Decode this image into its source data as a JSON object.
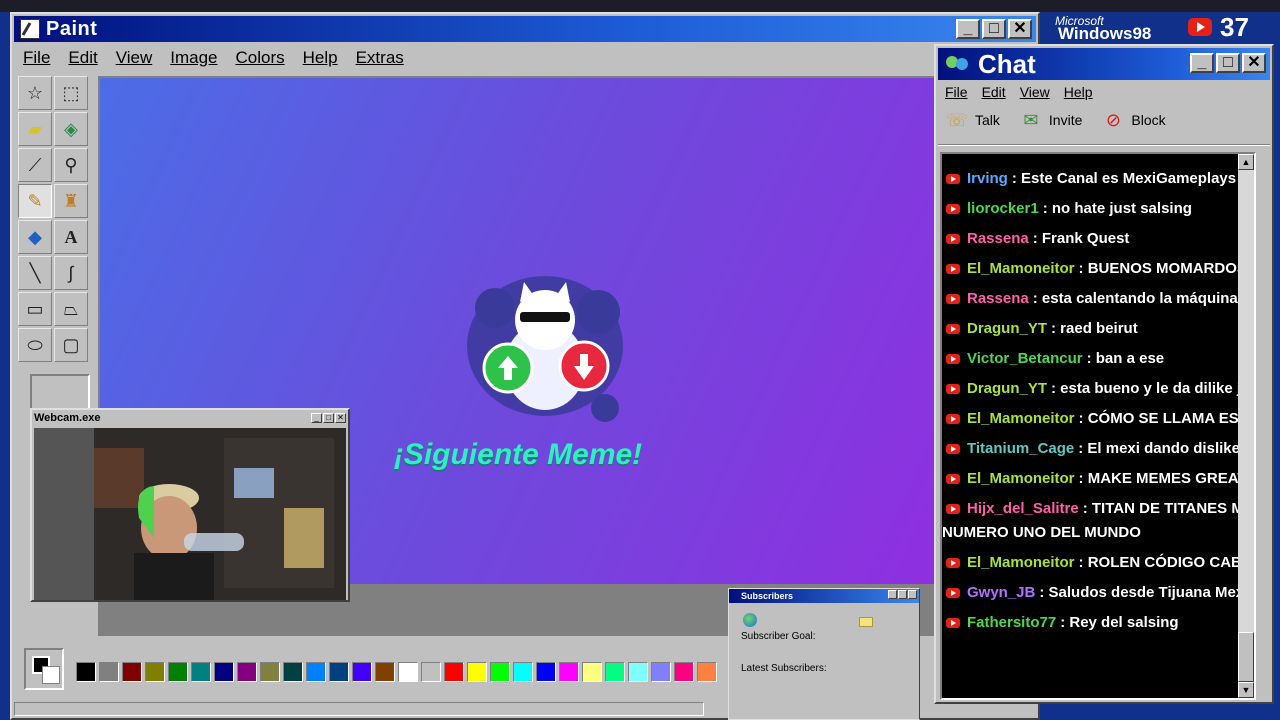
{
  "paint": {
    "title": "Paint",
    "menu": [
      "File",
      "Edit",
      "View",
      "Image",
      "Colors",
      "Help",
      "Extras"
    ],
    "canvas_text": "¡Siguiente Meme!",
    "palette": [
      "#000000",
      "#808080",
      "#800000",
      "#808000",
      "#008000",
      "#008080",
      "#000080",
      "#800080",
      "#808040",
      "#004040",
      "#0080ff",
      "#004080",
      "#4000ff",
      "#804000",
      "#ffffff",
      "#c0c0c0",
      "#ff0000",
      "#ffff00",
      "#00ff00",
      "#00ffff",
      "#0000ff",
      "#ff00ff",
      "#ffff80",
      "#00ff80",
      "#80ffff",
      "#8080ff",
      "#ff0080",
      "#ff8040"
    ]
  },
  "webcam": {
    "title": "Webcam.exe"
  },
  "badge": {
    "microsoft": "Microsoft",
    "windows": "Windows98",
    "viewer_count": "37"
  },
  "chat": {
    "title": "Chat",
    "menu": [
      "File",
      "Edit",
      "View",
      "Help"
    ],
    "tools": [
      {
        "label": "Talk",
        "icon": "talk-icon"
      },
      {
        "label": "Invite",
        "icon": "invite-icon"
      },
      {
        "label": "Block",
        "icon": "block-icon"
      }
    ],
    "messages": [
      {
        "user": "Irving",
        "color": "#5aa8ff",
        "text": ": Este Canal es MexiGameplays xd"
      },
      {
        "user": "liorocker1",
        "color": "#4dd64d",
        "text": ": no hate just salsing"
      },
      {
        "user": "Rassena",
        "color": "#ff5fa8",
        "text": ": Frank Quest"
      },
      {
        "user": "El_Mamoneitor",
        "color": "#a8e040",
        "text": ": BUENOS MOMARDOS, BA"
      },
      {
        "user": "Rassena",
        "color": "#ff5fa8",
        "text": ": esta calentando la máquina mem"
      },
      {
        "user": "Dragun_YT",
        "color": "#a8e040",
        "text": ": raed beirut"
      },
      {
        "user": "Victor_Betancur",
        "color": "#4dd64d",
        "text": ": ban a ese"
      },
      {
        "user": "Dragun_YT",
        "color": "#a8e040",
        "text": ": esta bueno y le da dilike jaja"
      },
      {
        "user": "El_Mamoneitor",
        "color": "#a8e040",
        "text": ": CÓMO SE LLAMA ESA PÁ"
      },
      {
        "user": "Titanium_Cage",
        "color": "#5fc8c0",
        "text": ": El mexi dando dislike para"
      },
      {
        "user": "El_Mamoneitor",
        "color": "#a8e040",
        "text": ": MAKE MEMES GREAT AGA"
      },
      {
        "user": "Hijx_del_Salitre",
        "color": "#ff5fa8",
        "text": ": TITAN DE TITANES MOST",
        "continuation": "NUMERO UNO DEL MUNDO"
      },
      {
        "user": "El_Mamoneitor",
        "color": "#a8e040",
        "text": ": ROLEN CÓDIGO CABRONE"
      },
      {
        "user": "Gwyn_JB",
        "color": "#b070ff",
        "text": ": Saludos desde Tijuana Mexiver g"
      },
      {
        "user": "Fathersito77",
        "color": "#4dd64d",
        "text": ": Rey del salsing"
      }
    ]
  },
  "subscribers": {
    "title": "Subscribers",
    "goal_label": "Subscriber Goal:",
    "latest_label": "Latest Subscribers:"
  }
}
